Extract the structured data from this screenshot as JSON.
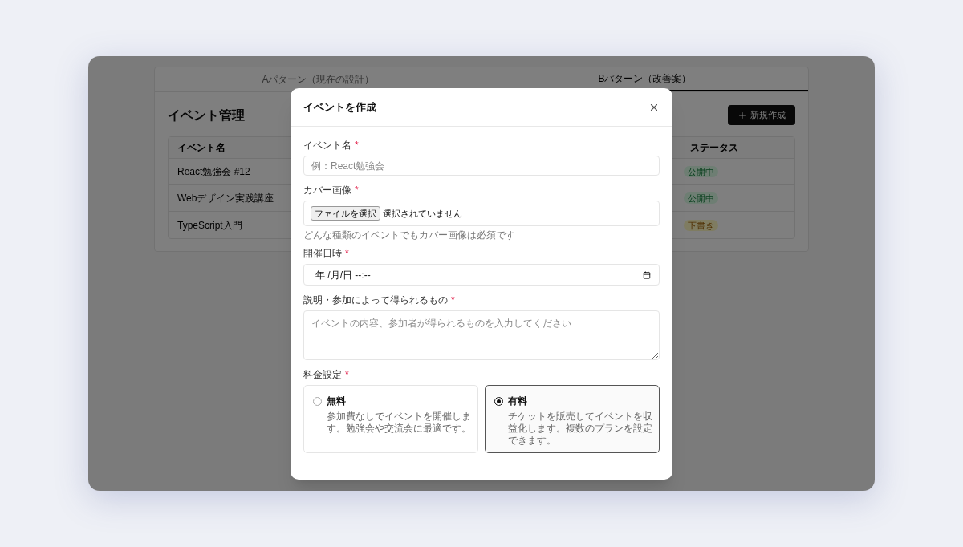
{
  "tabs": [
    {
      "label": "Aパターン（現在の設計）",
      "selected": false
    },
    {
      "label": "Bパターン（改善案）",
      "selected": true
    }
  ],
  "page": {
    "title": "イベント管理",
    "new_button": "新規作成"
  },
  "table": {
    "columns": [
      "イベント名",
      "ステータス"
    ],
    "rows": [
      {
        "name": "React勉強会 #12",
        "status": "公開中",
        "kind": "published"
      },
      {
        "name": "Webデザイン実践講座",
        "status": "公開中",
        "kind": "published"
      },
      {
        "name": "TypeScript入門",
        "status": "下書き",
        "kind": "draft"
      }
    ]
  },
  "dialog": {
    "title": "イベントを作成",
    "name_field": {
      "label": "イベント名",
      "required": "*",
      "placeholder": "例：React勉強会"
    },
    "cover_field": {
      "label": "カバー画像",
      "required": "*",
      "button": "ファイルを選択",
      "status": "選択されていません",
      "help": "どんな種類のイベントでもカバー画像は必須です"
    },
    "date_field": {
      "label": "開催日時",
      "required": "*",
      "value": "年 /月/日 --:--"
    },
    "description_field": {
      "label": "説明・参加によって得られるもの",
      "required": "*",
      "placeholder": "イベントの内容、参加者が得られるものを入力してください"
    },
    "pricing": {
      "label": "料金設定",
      "required": "*",
      "options": [
        {
          "title": "無料",
          "description": "参加費なしでイベントを開催します。勉強会や交流会に最適です。",
          "selected": false
        },
        {
          "title": "有料",
          "description": "チケットを販売してイベントを収益化します。複数のプランを設定できます。",
          "selected": true
        }
      ]
    }
  }
}
